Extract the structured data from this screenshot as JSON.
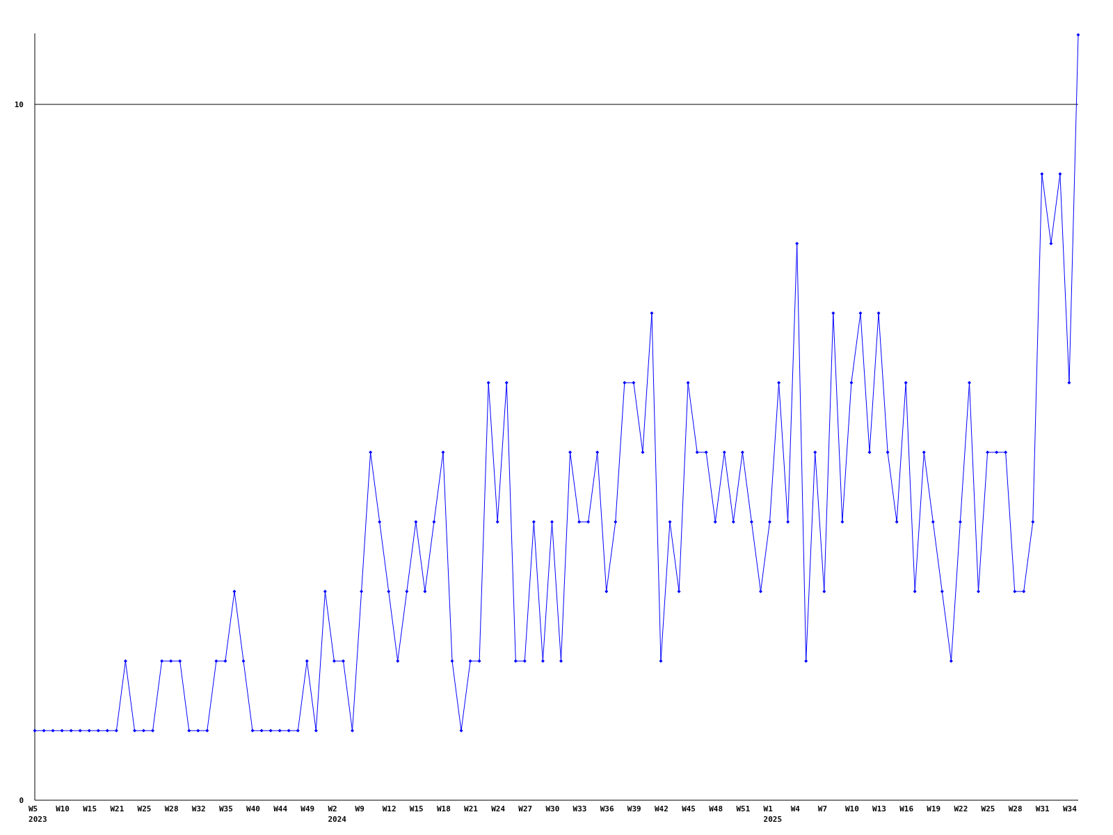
{
  "chart_data": {
    "type": "line",
    "categories": [
      "W5 2023",
      null,
      null,
      "W10",
      null,
      null,
      "W15",
      null,
      null,
      "W21",
      null,
      null,
      "W25",
      null,
      null,
      "W28",
      null,
      null,
      "W32",
      null,
      null,
      "W35",
      null,
      null,
      "W40",
      null,
      null,
      "W44",
      null,
      null,
      "W49",
      null,
      null,
      "W2 2024",
      null,
      null,
      "W9",
      null,
      null,
      "W12",
      null,
      null,
      "W15",
      null,
      null,
      "W18",
      null,
      null,
      "W21",
      null,
      null,
      "W24",
      null,
      null,
      "W27",
      null,
      null,
      "W30",
      null,
      null,
      "W33",
      null,
      null,
      "W36",
      null,
      null,
      "W39",
      null,
      null,
      "W42",
      null,
      null,
      "W45",
      null,
      null,
      "W48",
      null,
      null,
      "W51",
      null,
      null,
      "W1 2025",
      null,
      null,
      "W4",
      null,
      null,
      "W7",
      null,
      null,
      "W10",
      null,
      null,
      "W13",
      null,
      null,
      "W16",
      null,
      null,
      "W19",
      null,
      null,
      "W22",
      null,
      null,
      "W25",
      null,
      null,
      "W28",
      null,
      null,
      "W31",
      null,
      null,
      "W34",
      null
    ],
    "series": [
      {
        "color": "#0000ff",
        "marker": "diamond",
        "values": [
          1,
          1,
          1,
          1,
          1,
          1,
          1,
          1,
          1,
          1,
          2,
          1,
          1,
          1,
          2,
          2,
          2,
          1,
          1,
          1,
          2,
          2,
          3,
          2,
          1,
          1,
          1,
          1,
          1,
          1,
          2,
          1,
          3,
          2,
          2,
          1,
          3,
          5,
          4,
          3,
          2,
          3,
          4,
          3,
          4,
          5,
          2,
          1,
          2,
          2,
          6,
          4,
          6,
          2,
          2,
          4,
          2,
          4,
          2,
          5,
          4,
          4,
          5,
          3,
          4,
          6,
          6,
          5,
          7,
          2,
          4,
          3,
          6,
          5,
          5,
          4,
          5,
          4,
          5,
          4,
          3,
          4,
          6,
          4,
          8,
          2,
          5,
          3,
          7,
          4,
          6,
          7,
          5,
          7,
          5,
          4,
          6,
          3,
          5,
          4,
          3,
          2,
          4,
          6,
          3,
          5,
          5,
          5,
          3,
          3,
          4,
          9,
          8,
          9,
          6,
          11
        ]
      }
    ],
    "ylim": [
      0,
      11
    ],
    "yticks": [
      0,
      10
    ]
  }
}
